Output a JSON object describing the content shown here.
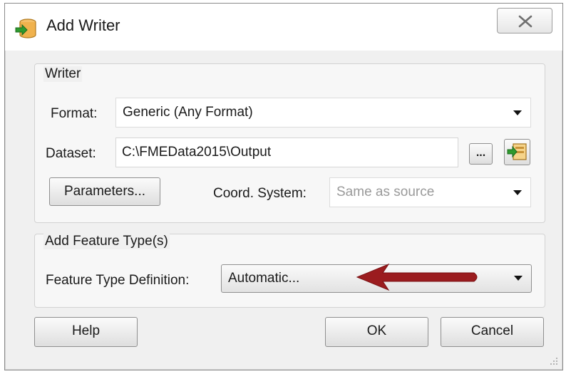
{
  "window": {
    "title": "Add Writer",
    "app_icon": "fme-writer-icon",
    "close_icon": "close-x-icon"
  },
  "writer_group": {
    "label": "Writer",
    "format_label": "Format:",
    "format_value": "Generic (Any Format)",
    "dataset_label": "Dataset:",
    "dataset_value": "C:\\FMEData2015\\Output",
    "browse_label": "...",
    "dataset_icon": "dataset-picker-icon",
    "parameters_label": "Parameters...",
    "coord_label": "Coord. System:",
    "coord_value": "Same as source"
  },
  "feature_group": {
    "label": "Add Feature Type(s)",
    "definition_label": "Feature Type Definition:",
    "definition_value": "Automatic...",
    "annotation_icon": "red-arrow-annotation"
  },
  "buttons": {
    "help": "Help",
    "ok": "OK",
    "cancel": "Cancel"
  },
  "colors": {
    "window_bg": "#f0f0f0",
    "annotation_red": "#9b1c1f"
  }
}
